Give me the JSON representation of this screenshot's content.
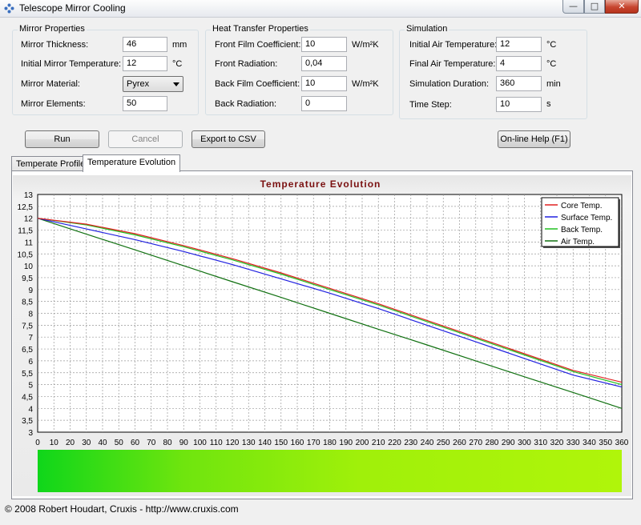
{
  "window": {
    "title": "Telescope Mirror Cooling",
    "min": "—",
    "max": "□",
    "close": "✕"
  },
  "groups": {
    "mirror": {
      "title": "Mirror Properties",
      "thickness_label": "Mirror Thickness:",
      "thickness_value": "46",
      "thickness_unit": "mm",
      "init_temp_label": "Initial Mirror Temperature:",
      "init_temp_value": "12",
      "init_temp_unit": "°C",
      "material_label": "Mirror Material:",
      "material_value": "Pyrex",
      "elements_label": "Mirror Elements:",
      "elements_value": "50"
    },
    "heat": {
      "title": "Heat Transfer Properties",
      "front_film_label": "Front Film Coefficient:",
      "front_film_value": "10",
      "front_film_unit": "W/m²K",
      "front_rad_label": "Front Radiation:",
      "front_rad_value": "0,04",
      "back_film_label": "Back Film Coefficient:",
      "back_film_value": "10",
      "back_film_unit": "W/m²K",
      "back_rad_label": "Back Radiation:",
      "back_rad_value": "0"
    },
    "sim": {
      "title": "Simulation",
      "init_air_label": "Initial Air Temperature:",
      "init_air_value": "12",
      "init_air_unit": "°C",
      "final_air_label": "Final Air Temperature:",
      "final_air_value": "4",
      "final_air_unit": "°C",
      "duration_label": "Simulation Duration:",
      "duration_value": "360",
      "duration_unit": "min",
      "step_label": "Time Step:",
      "step_value": "10",
      "step_unit": "s"
    }
  },
  "buttons": {
    "run": "Run",
    "cancel": "Cancel",
    "export": "Export to CSV",
    "help": "On-line Help (F1)"
  },
  "tabs": [
    "Temperate Profile",
    "Temperature Evolution"
  ],
  "status": "© 2008 Robert Houdart, Cruxis  -  http://www.cruxis.com",
  "colors": {
    "title": "#7a1010",
    "core": "#e02020",
    "surface": "#2020e0",
    "back": "#20c020",
    "air": "#107010"
  },
  "chart_data": {
    "type": "line",
    "title": "Temperature Evolution",
    "xlim": [
      0,
      360
    ],
    "ylim": [
      3,
      13
    ],
    "x_ticks": [
      0,
      10,
      20,
      30,
      40,
      50,
      60,
      70,
      80,
      90,
      100,
      110,
      120,
      130,
      140,
      150,
      160,
      170,
      180,
      190,
      200,
      210,
      220,
      230,
      240,
      250,
      260,
      270,
      280,
      290,
      300,
      310,
      320,
      330,
      340,
      350,
      360
    ],
    "y_ticks": [
      "3",
      "3,5",
      "4",
      "4,5",
      "5",
      "5,5",
      "6",
      "6,5",
      "7",
      "7,5",
      "8",
      "8,5",
      "9",
      "9,5",
      "10",
      "10,5",
      "11",
      "11,5",
      "12",
      "12,5",
      "13"
    ],
    "y_tick_values": [
      3,
      3.5,
      4,
      4.5,
      5,
      5.5,
      6,
      6.5,
      7,
      7.5,
      8,
      8.5,
      9,
      9.5,
      10,
      10.5,
      11,
      11.5,
      12,
      12.5,
      13
    ],
    "grid": true,
    "legend_position": "top-right",
    "x": [
      0,
      30,
      60,
      90,
      120,
      150,
      180,
      210,
      240,
      270,
      300,
      330,
      360
    ],
    "series": [
      {
        "name": "Core Temp.",
        "color": "#e02020",
        "values": [
          12.0,
          11.75,
          11.35,
          10.85,
          10.3,
          9.7,
          9.05,
          8.4,
          7.7,
          7.0,
          6.3,
          5.6,
          5.1
        ]
      },
      {
        "name": "Surface Temp.",
        "color": "#2020e0",
        "values": [
          12.0,
          11.55,
          11.1,
          10.6,
          10.05,
          9.45,
          8.85,
          8.2,
          7.5,
          6.8,
          6.1,
          5.4,
          4.9
        ]
      },
      {
        "name": "Back Temp.",
        "color": "#20c020",
        "values": [
          12.0,
          11.72,
          11.3,
          10.8,
          10.25,
          9.65,
          9.0,
          8.35,
          7.65,
          6.95,
          6.25,
          5.55,
          5.0
        ]
      },
      {
        "name": "Air Temp.",
        "color": "#107010",
        "values": [
          12.0,
          11.33,
          10.67,
          10.0,
          9.33,
          8.67,
          8.0,
          7.33,
          6.67,
          6.0,
          5.33,
          4.67,
          4.0
        ]
      }
    ]
  }
}
